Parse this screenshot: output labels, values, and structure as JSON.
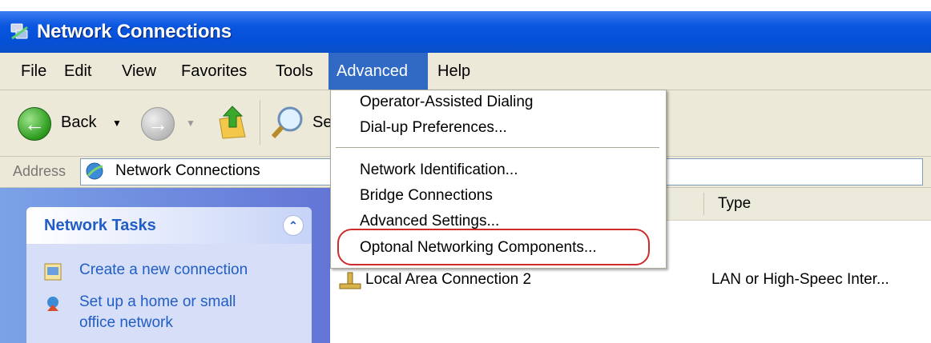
{
  "window": {
    "title": "Network Connections"
  },
  "menubar": {
    "items": [
      "File",
      "Edit",
      "View",
      "Favorites",
      "Tools",
      "Advanced",
      "Help"
    ],
    "active": "Advanced"
  },
  "toolbar": {
    "back_label": "Back",
    "search_label": "Se"
  },
  "address": {
    "label": "Address",
    "value": "Network Connections"
  },
  "left_pane": {
    "title": "Network Tasks",
    "tasks": [
      "Create a new connection",
      "Set up a home or small",
      "office network"
    ]
  },
  "content": {
    "column_type": "Type",
    "rows": [
      {
        "name": "Local Area Connection 2",
        "type": "LAN or High-Speec Inter..."
      }
    ]
  },
  "advanced_menu": {
    "items": [
      "Operator-Assisted Dialing",
      "Dial-up Preferences...",
      "Network Identification...",
      "Bridge Connections",
      "Advanced Settings...",
      "Optonal Networking Components..."
    ],
    "highlighted": "Optonal Networking Components..."
  },
  "colors": {
    "title_bar": "#0550d8",
    "menu_bg": "#ece9d8",
    "menu_highlight": "#316ac5",
    "annotation": "#cf2b2b"
  }
}
